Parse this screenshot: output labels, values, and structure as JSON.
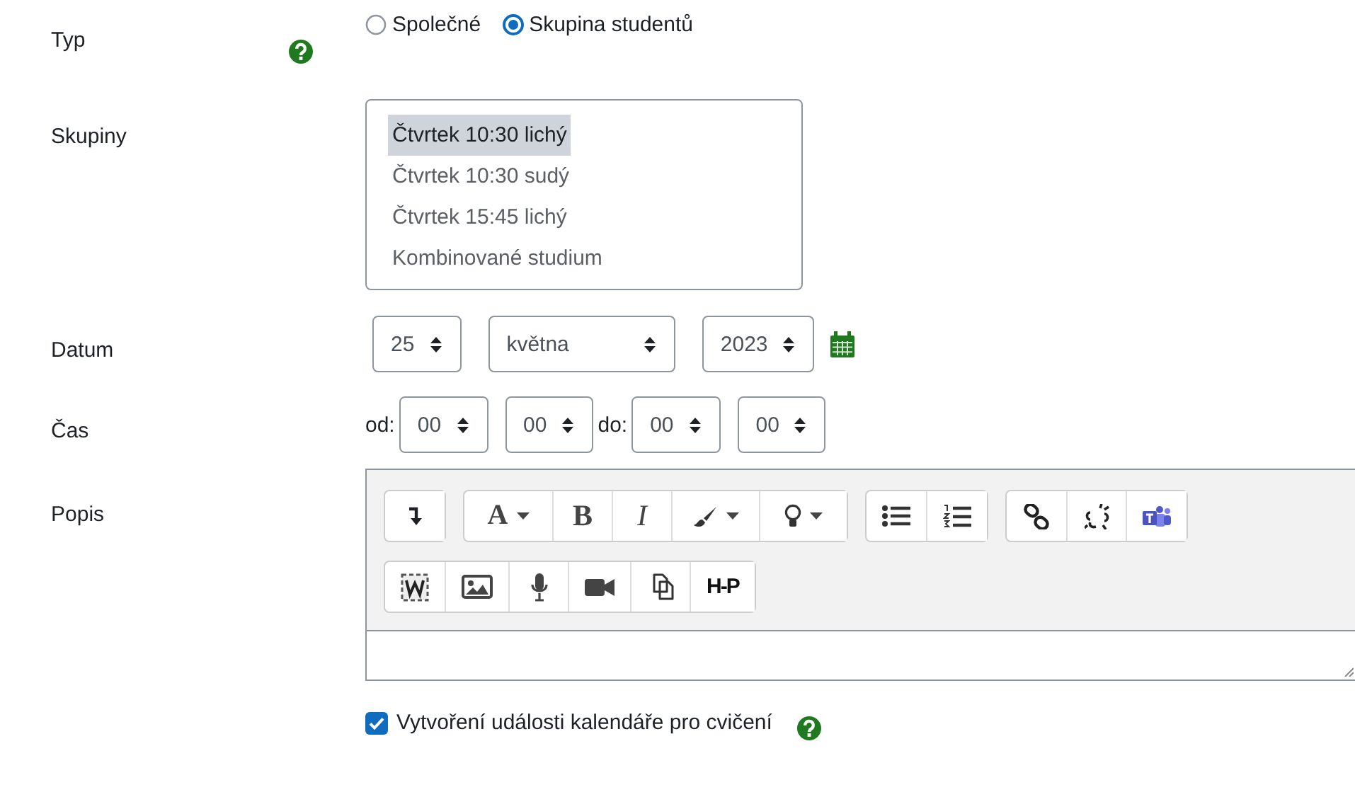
{
  "fields": [
    {
      "kind": "radio",
      "label": "Typ",
      "help": true,
      "options": [
        {
          "label": "Společné",
          "selected": false
        },
        {
          "label": "Skupina studentů",
          "selected": true
        }
      ]
    },
    {
      "kind": "listbox",
      "label": "Skupiny",
      "items": [
        {
          "label": "Čtvrtek 10:30 lichý",
          "selected": true
        },
        {
          "label": "Čtvrtek 10:30 sudý",
          "selected": false
        },
        {
          "label": "Čtvrtek 15:45 lichý",
          "selected": false
        },
        {
          "label": "Kombinované studium",
          "selected": false
        }
      ]
    },
    {
      "kind": "date",
      "label": "Datum",
      "parts": [
        {
          "kind": "select",
          "value": "25"
        },
        {
          "kind": "select",
          "value": "května"
        },
        {
          "kind": "select",
          "value": "2023"
        },
        {
          "kind": "calendar"
        }
      ]
    },
    {
      "kind": "time",
      "label": "Čas",
      "parts": [
        {
          "kind": "text",
          "text": "od:"
        },
        {
          "kind": "select",
          "value": "00"
        },
        {
          "kind": "select",
          "value": "00"
        },
        {
          "kind": "text",
          "text": "do:"
        },
        {
          "kind": "select",
          "value": "00"
        },
        {
          "kind": "select",
          "value": "00"
        }
      ]
    },
    {
      "kind": "editor",
      "label": "Popis",
      "toolbar": [
        [
          [
            {
              "kind": "toggle"
            }
          ],
          [
            {
              "kind": "font",
              "label": "A",
              "dropdown": true
            },
            {
              "kind": "bold",
              "label": "B"
            },
            {
              "kind": "italic",
              "label": "I"
            },
            {
              "kind": "brush",
              "dropdown": true
            },
            {
              "kind": "bulb",
              "dropdown": true
            }
          ],
          [
            {
              "kind": "bullets"
            },
            {
              "kind": "numbers"
            }
          ],
          [
            {
              "kind": "link"
            },
            {
              "kind": "unlink"
            },
            {
              "kind": "teams"
            }
          ]
        ],
        [
          [
            {
              "kind": "word"
            },
            {
              "kind": "image"
            },
            {
              "kind": "mic"
            },
            {
              "kind": "video"
            },
            {
              "kind": "copy"
            },
            {
              "kind": "h5p",
              "label": "H-P"
            }
          ]
        ]
      ]
    },
    {
      "kind": "checkbox",
      "label": "Vytvoření události kalendáře pro cvičení",
      "checked": true,
      "help": true
    }
  ]
}
